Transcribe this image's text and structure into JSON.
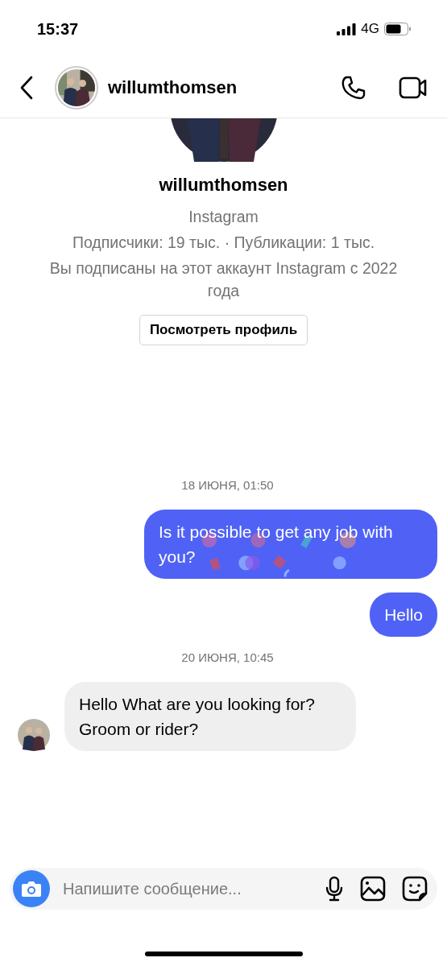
{
  "status_bar": {
    "time": "15:37",
    "network": "4G"
  },
  "header": {
    "username": "willumthomsen"
  },
  "profile": {
    "username": "willumthomsen",
    "platform": "Instagram",
    "stats": "Подписчики: 19 тыс. · Публикации: 1 тыс.",
    "followed_since": "Вы подписаны на этот аккаунт Instagram с 2022 года",
    "view_profile_button": "Посмотреть профиль"
  },
  "thread": [
    {
      "kind": "date",
      "text": "18 ИЮНЯ, 01:50"
    },
    {
      "kind": "outgoing",
      "text": "Is it possible to get any job with you?",
      "effect": true
    },
    {
      "kind": "outgoing",
      "text": "Hello",
      "effect": false
    },
    {
      "kind": "date",
      "text": "20 ИЮНЯ, 10:45"
    },
    {
      "kind": "incoming",
      "text": "Hello What are you looking for? Groom or rider?"
    }
  ],
  "composer": {
    "placeholder": "Напишите сообщение..."
  }
}
